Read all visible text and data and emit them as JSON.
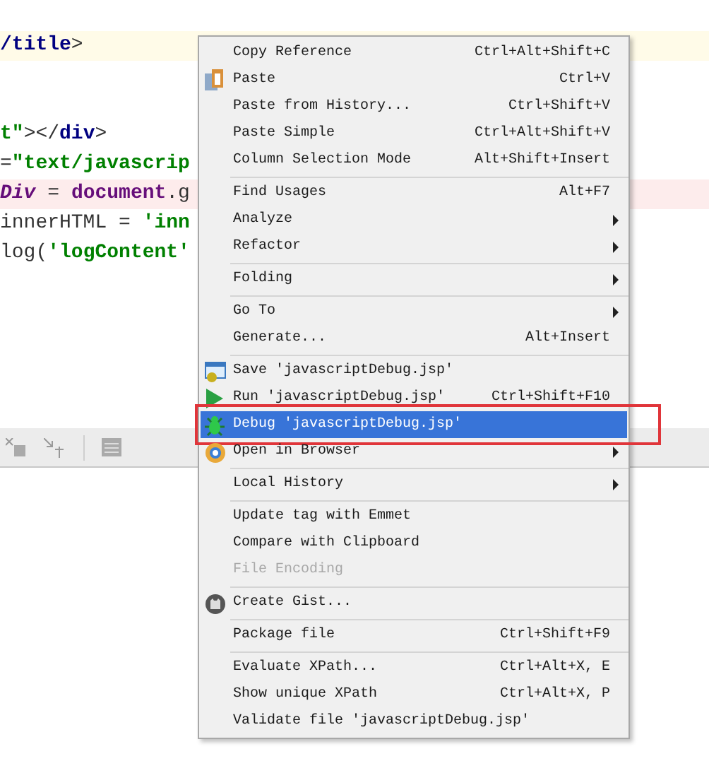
{
  "editor": {
    "lines": [
      {
        "kind": "code",
        "current": true,
        "error": false,
        "tokens": [
          {
            "kind": "tag",
            "text": "/title"
          },
          {
            "kind": "plain",
            "text": ">"
          }
        ]
      },
      {
        "kind": "blank"
      },
      {
        "kind": "blank"
      },
      {
        "kind": "code",
        "current": false,
        "error": false,
        "tokens": [
          {
            "kind": "string",
            "text": "t\""
          },
          {
            "kind": "plain",
            "text": "></"
          },
          {
            "kind": "tag",
            "text": "div"
          },
          {
            "kind": "plain",
            "text": ">"
          }
        ]
      },
      {
        "kind": "code",
        "current": false,
        "error": false,
        "tokens": [
          {
            "kind": "plain",
            "text": "="
          },
          {
            "kind": "string",
            "text": "\"text/javascrip"
          }
        ]
      },
      {
        "kind": "code",
        "current": false,
        "error": true,
        "tokens": [
          {
            "kind": "variable",
            "text": "Div"
          },
          {
            "kind": "plain",
            "text": " = "
          },
          {
            "kind": "keyword",
            "text": "document"
          },
          {
            "kind": "plain",
            "text": ".g"
          }
        ]
      },
      {
        "kind": "code",
        "current": false,
        "error": false,
        "tokens": [
          {
            "kind": "plain",
            "text": "innerHTML = "
          },
          {
            "kind": "string",
            "text": "'inn"
          }
        ]
      },
      {
        "kind": "code",
        "current": false,
        "error": false,
        "tokens": [
          {
            "kind": "plain",
            "text": "log("
          },
          {
            "kind": "string",
            "text": "'logContent'"
          }
        ]
      }
    ]
  },
  "context_menu": {
    "items": [
      {
        "kind": "item",
        "label": "Copy Reference",
        "shortcut": "Ctrl+Alt+Shift+C",
        "submenu": false,
        "disabled": false,
        "selected": false
      },
      {
        "kind": "paste",
        "label": "Paste",
        "shortcut": "Ctrl+V",
        "submenu": false,
        "disabled": false,
        "selected": false
      },
      {
        "kind": "item",
        "label": "Paste from History...",
        "shortcut": "Ctrl+Shift+V",
        "submenu": false,
        "disabled": false,
        "selected": false
      },
      {
        "kind": "item",
        "label": "Paste Simple",
        "shortcut": "Ctrl+Alt+Shift+V",
        "submenu": false,
        "disabled": false,
        "selected": false
      },
      {
        "kind": "item",
        "label": "Column Selection Mode",
        "shortcut": "Alt+Shift+Insert",
        "submenu": false,
        "disabled": false,
        "selected": false
      },
      {
        "kind": "separator"
      },
      {
        "kind": "item",
        "label": "Find Usages",
        "shortcut": "Alt+F7",
        "submenu": false,
        "disabled": false,
        "selected": false
      },
      {
        "kind": "item",
        "label": "Analyze",
        "submenu": true,
        "disabled": false,
        "selected": false
      },
      {
        "kind": "item",
        "label": "Refactor",
        "submenu": true,
        "disabled": false,
        "selected": false
      },
      {
        "kind": "separator"
      },
      {
        "kind": "item",
        "label": "Folding",
        "submenu": true,
        "disabled": false,
        "selected": false
      },
      {
        "kind": "separator"
      },
      {
        "kind": "item",
        "label": "Go To",
        "submenu": true,
        "disabled": false,
        "selected": false
      },
      {
        "kind": "item",
        "label": "Generate...",
        "shortcut": "Alt+Insert",
        "submenu": false,
        "disabled": false,
        "selected": false
      },
      {
        "kind": "separator"
      },
      {
        "kind": "save",
        "label": "Save 'javascriptDebug.jsp'",
        "submenu": false,
        "disabled": false,
        "selected": false
      },
      {
        "kind": "run",
        "label": "Run 'javascriptDebug.jsp'",
        "shortcut": "Ctrl+Shift+F10",
        "submenu": false,
        "disabled": false,
        "selected": false
      },
      {
        "kind": "debug",
        "label": "Debug 'javascriptDebug.jsp'",
        "submenu": false,
        "disabled": false,
        "selected": true,
        "outlined": true
      },
      {
        "kind": "browser",
        "label": "Open in Browser",
        "submenu": true,
        "disabled": false,
        "selected": false
      },
      {
        "kind": "separator"
      },
      {
        "kind": "item",
        "label": "Local History",
        "submenu": true,
        "disabled": false,
        "selected": false
      },
      {
        "kind": "separator"
      },
      {
        "kind": "item",
        "label": "Update tag with Emmet",
        "submenu": false,
        "disabled": false,
        "selected": false
      },
      {
        "kind": "item",
        "label": "Compare with Clipboard",
        "submenu": false,
        "disabled": false,
        "selected": false
      },
      {
        "kind": "item",
        "label": "File Encoding",
        "submenu": false,
        "disabled": true,
        "selected": false
      },
      {
        "kind": "separator"
      },
      {
        "kind": "gist",
        "label": "Create Gist...",
        "submenu": false,
        "disabled": false,
        "selected": false
      },
      {
        "kind": "separator"
      },
      {
        "kind": "item",
        "label": "Package file",
        "shortcut": "Ctrl+Shift+F9",
        "submenu": false,
        "disabled": false,
        "selected": false
      },
      {
        "kind": "separator"
      },
      {
        "kind": "item",
        "label": "Evaluate XPath...",
        "shortcut": "Ctrl+Alt+X, E",
        "submenu": false,
        "disabled": false,
        "selected": false
      },
      {
        "kind": "item",
        "label": "Show unique XPath",
        "shortcut": "Ctrl+Alt+X, P",
        "submenu": false,
        "disabled": false,
        "selected": false
      },
      {
        "kind": "item",
        "label": "Validate file 'javascriptDebug.jsp'",
        "submenu": false,
        "disabled": false,
        "selected": false
      }
    ]
  }
}
